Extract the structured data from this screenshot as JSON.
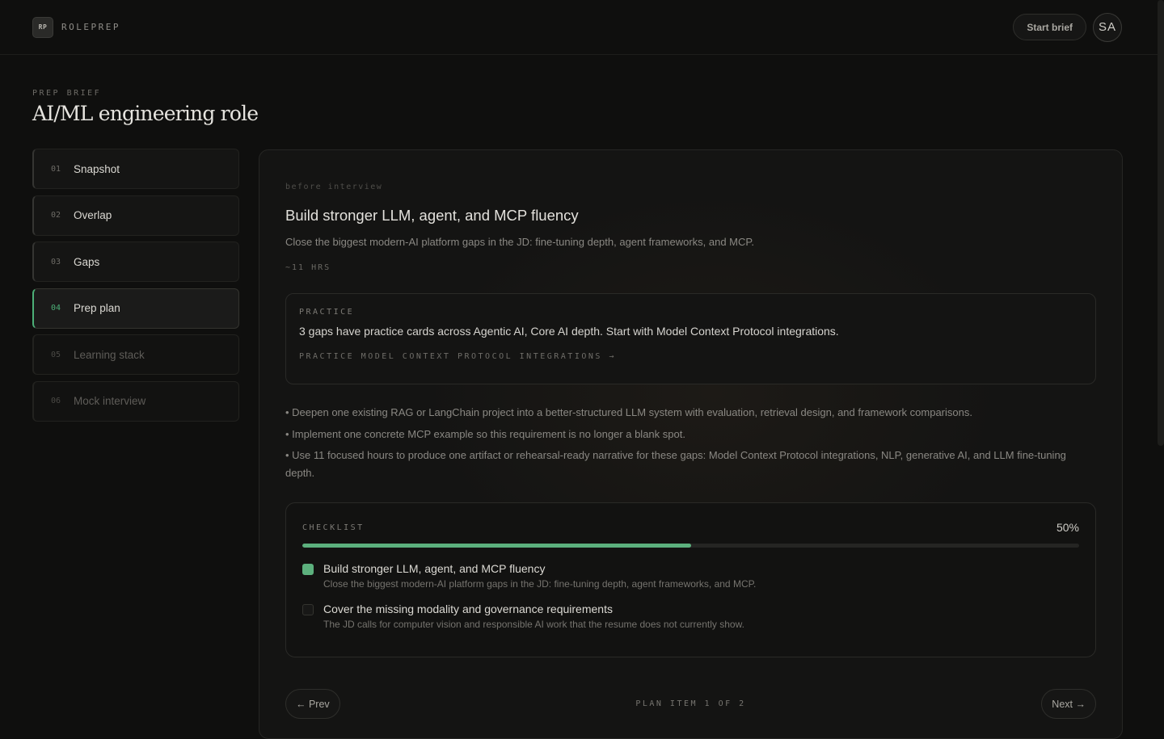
{
  "app": {
    "badge": "RP",
    "name": "ROLEPREP"
  },
  "header": {
    "start_brief": "Start brief",
    "avatar_initials": "SA"
  },
  "page": {
    "eyebrow": "PREP BRIEF",
    "title": "AI/ML engineering role"
  },
  "sidebar": {
    "items": [
      {
        "num": "01",
        "label": "Snapshot"
      },
      {
        "num": "02",
        "label": "Overlap"
      },
      {
        "num": "03",
        "label": "Gaps"
      },
      {
        "num": "04",
        "label": "Prep plan"
      },
      {
        "num": "05",
        "label": "Learning stack"
      },
      {
        "num": "06",
        "label": "Mock interview"
      }
    ]
  },
  "plan_item": {
    "when": "before interview",
    "title": "Build stronger LLM, agent, and MCP fluency",
    "description": "Close the biggest modern-AI platform gaps in the JD: fine-tuning depth, agent frameworks, and MCP.",
    "hours": "~11 HRS",
    "practice": {
      "label": "PRACTICE",
      "text": "3 gaps have practice cards across Agentic AI, Core AI depth. Start with Model Context Protocol integrations.",
      "link": "PRACTICE MODEL CONTEXT PROTOCOL INTEGRATIONS →"
    },
    "bullets": [
      "• Deepen one existing RAG or LangChain project into a better-structured LLM system with evaluation, retrieval design, and framework comparisons.",
      "• Implement one concrete MCP example so this requirement is no longer a blank spot.",
      "• Use 11 focused hours to produce one artifact or rehearsal-ready narrative for these gaps: Model Context Protocol integrations, NLP, generative AI, and LLM fine-tuning depth."
    ]
  },
  "checklist": {
    "label": "CHECKLIST",
    "percent_text": "50%",
    "progress": 0.5,
    "accent": "#5cb07d",
    "items": [
      {
        "checked": true,
        "title": "Build stronger LLM, agent, and MCP fluency",
        "sub": "Close the biggest modern-AI platform gaps in the JD: fine-tuning depth, agent frameworks, and MCP."
      },
      {
        "checked": false,
        "title": "Cover the missing modality and governance requirements",
        "sub": "The JD calls for computer vision and responsible AI work that the resume does not currently show."
      }
    ]
  },
  "pager": {
    "prev": "← Prev",
    "status": "PLAN ITEM 1 OF 2",
    "next": "Next →"
  }
}
